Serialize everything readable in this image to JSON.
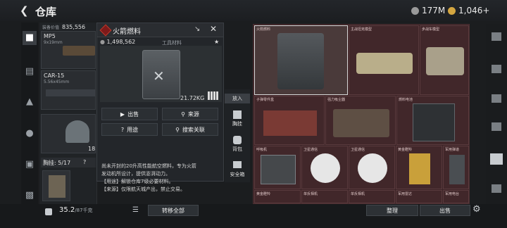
{
  "header": {
    "back_icon": "arrow-left-icon",
    "title": "仓库",
    "currency1": "177M",
    "currency2": "1,046+"
  },
  "loadout": {
    "equip_value_label": "装备价值",
    "equip_value": "835,556",
    "weapon1_name": "MP5",
    "weapon1_sub": "9x19mm",
    "weapon2_name": "CAR-15",
    "weapon2_sub": "5.56x45mm",
    "helmet_count": "18",
    "chest_label": "胸挂: 5/17",
    "chest_help": "?"
  },
  "popup": {
    "title": "火箭燃料",
    "price": "1,498,562",
    "tag": "工具材料",
    "weight": "21.72KG",
    "buttons": {
      "sell": "出售",
      "source": "来源",
      "usage": "用途",
      "search": "搜索关联"
    },
    "desc": [
      "尚未开封的20升高性能航空燃料，专为火箭",
      "发动机所设计，提供澎湃动力。",
      "【用途】解锁仓库7级必要材料。",
      "【来源】仅限航天城产出，禁止交易。"
    ]
  },
  "side_tabs": {
    "put_in": "放入",
    "chest": "胸挂",
    "backpack": "背包",
    "safe_box": "安全箱"
  },
  "grid_items": [
    {
      "name": "火箭燃料"
    },
    {
      "name": "主战坦克模型"
    },
    {
      "name": "步战车模型"
    },
    {
      "name": "子弹零件盒"
    },
    {
      "name": "强力吸尘器"
    },
    {
      "name": "燃料电池"
    },
    {
      "name": "呼吸机"
    },
    {
      "name": "卫星通信"
    },
    {
      "name": "卫星通信"
    },
    {
      "name": "黄金瞪羚"
    },
    {
      "name": "军用弹道"
    },
    {
      "name": "黄金瞪羚"
    },
    {
      "name": "单反相机"
    },
    {
      "name": "单反相机"
    },
    {
      "name": "军用雷达"
    },
    {
      "name": "军用电台"
    }
  ],
  "bottom": {
    "capacity": "35.2",
    "capacity_max": "/87千克",
    "transfer_all": "转移全部",
    "organize": "整理",
    "sell": "出售",
    "settings_icon": "gear-icon"
  },
  "colors": {
    "accent_red": "#c0392b",
    "grid_bg": "#3a2326"
  }
}
